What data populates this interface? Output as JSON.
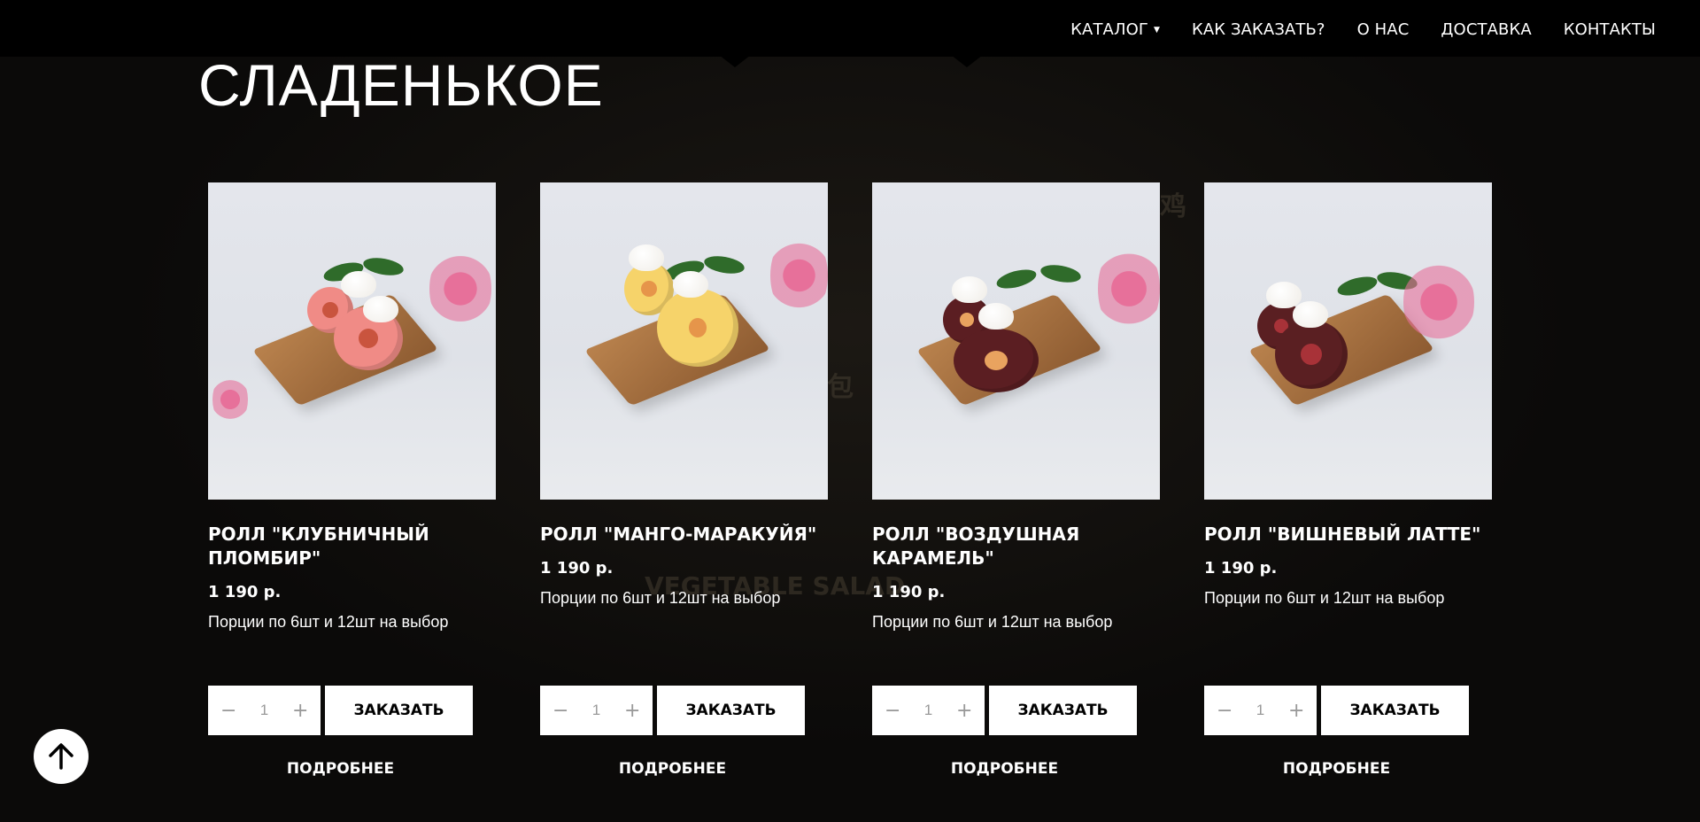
{
  "nav": {
    "items": [
      {
        "label": "КАТАЛОГ",
        "has_dropdown": true
      },
      {
        "label": "КАК ЗАКАЗАТЬ?"
      },
      {
        "label": "О НАС"
      },
      {
        "label": "ДОСТАВКА"
      },
      {
        "label": "КОНТАКТЫ"
      }
    ],
    "dropdown_icon": "caret-down-icon"
  },
  "section": {
    "title": "СЛАДЕНЬКОЕ"
  },
  "products": [
    {
      "name": "РОЛЛ \"КЛУБНИЧНЫЙ ПЛОМБИР\"",
      "price": "1 190 р.",
      "description": "Порции по 6шт и 12шт на выбор",
      "quantity": "1",
      "order_label": "ЗАКАЗАТЬ",
      "more_label": "ПОДРОБНЕЕ",
      "roll_color": "#f08b86",
      "core_color": "#c9543e"
    },
    {
      "name": "РОЛЛ \"МАНГО-МАРАКУЙЯ\"",
      "price": "1 190 р.",
      "description": "Порции по 6шт и 12шт на выбор",
      "quantity": "1",
      "order_label": "ЗАКАЗАТЬ",
      "more_label": "ПОДРОБНЕЕ",
      "roll_color": "#f6d36a",
      "core_color": "#e6954a"
    },
    {
      "name": "РОЛЛ \"ВОЗДУШНАЯ КАРАМЕЛЬ\"",
      "price": "1 190 р.",
      "description": "Порции по 6шт и 12шт на выбор",
      "quantity": "1",
      "order_label": "ЗАКАЗАТЬ",
      "more_label": "ПОДРОБНЕЕ",
      "roll_color": "#5b1e22",
      "core_color": "#e9a35f"
    },
    {
      "name": "РОЛЛ \"ВИШНЕВЫЙ ЛАТТЕ\"",
      "price": "1 190 р.",
      "description": "Порции по 6шт и 12шт на выбор",
      "quantity": "1",
      "order_label": "ЗАКАЗАТЬ",
      "more_label": "ПОДРОБНЕЕ",
      "roll_color": "#5a1f22",
      "core_color": "#a83238"
    }
  ],
  "stepper": {
    "minus": "−",
    "plus": "+"
  },
  "icons": {
    "scroll_top": "arrow-up-icon"
  },
  "colors": {
    "background": "#0a0908",
    "header": "#000000",
    "button_bg": "#ffffff",
    "button_text": "#000000"
  }
}
